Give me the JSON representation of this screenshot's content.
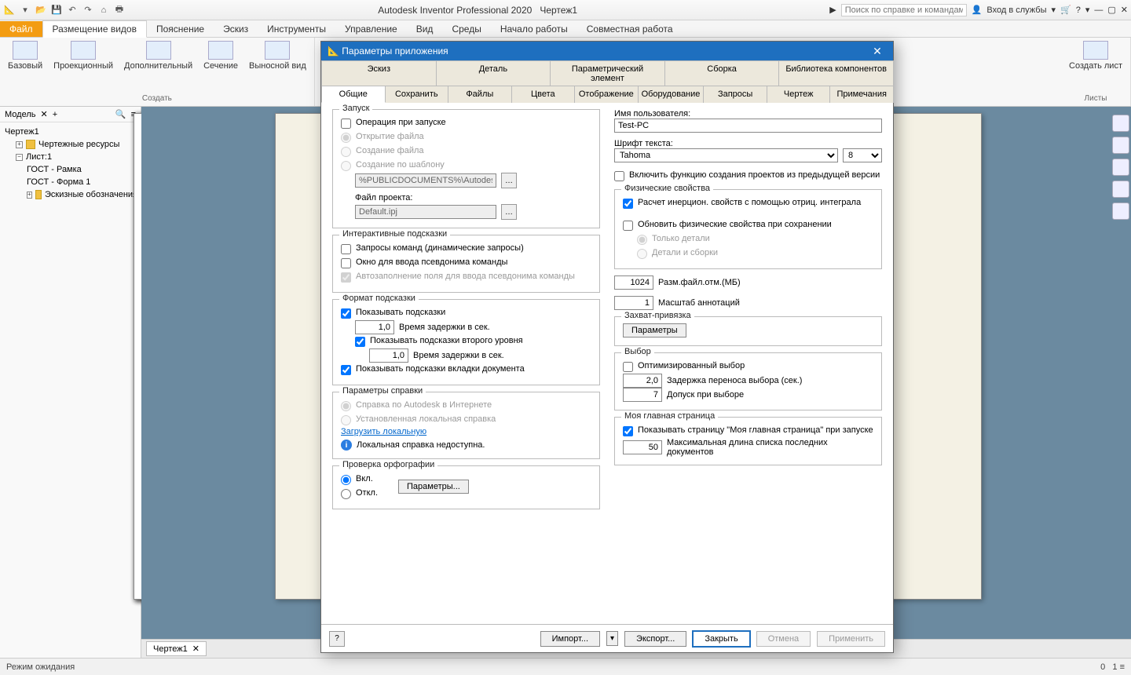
{
  "app": {
    "title": "Autodesk Inventor Professional 2020",
    "doc": "Чертеж1"
  },
  "qat": {
    "search_placeholder": "Поиск по справке и командам.",
    "signin": "Вход в службы"
  },
  "ribbon": {
    "file": "Файл",
    "tabs": [
      "Размещение видов",
      "Пояснение",
      "Эскиз",
      "Инструменты",
      "Управление",
      "Вид",
      "Среды",
      "Начало работы",
      "Совместная работа"
    ],
    "active_tab": 0,
    "groups": {
      "create": {
        "label": "Создать",
        "items": [
          "Базовый",
          "Проекционный",
          "Дополнительный",
          "Сечение",
          "Выносной вид"
        ]
      },
      "sheets": {
        "label": "Листы",
        "items": [
          "Создать лист"
        ]
      }
    }
  },
  "model": {
    "title": "Модель",
    "root": "Чертеж1",
    "resources": "Чертежные ресурсы",
    "sheet": "Лист:1",
    "children": [
      "ГОСТ - Рамка",
      "ГОСТ - Форма 1",
      "Эскизные обозначения"
    ]
  },
  "doc_tab": "Чертеж1",
  "status": {
    "left": "Режим ожидания",
    "right1": "0",
    "right2": "1"
  },
  "dialog": {
    "title": "Параметры приложения",
    "tabs_row1": [
      "Эскиз",
      "Деталь",
      "Параметрический элемент",
      "Сборка",
      "Библиотека компонентов"
    ],
    "tabs_row2": [
      "Общие",
      "Сохранить",
      "Файлы",
      "Цвета",
      "Отображение",
      "Оборудование",
      "Запросы",
      "Чертеж",
      "Примечания"
    ],
    "active": "Общие",
    "startup": {
      "title": "Запуск",
      "op_label": "Операция при запуске",
      "r1": "Открытие файла",
      "r2": "Создание файла",
      "r3": "Создание по шаблону",
      "template_path": "%PUBLICDOCUMENTS%\\Autodesk\\Inv",
      "project_label": "Файл проекта:",
      "project_file": "Default.ipj"
    },
    "hints": {
      "title": "Интерактивные подсказки",
      "c1": "Запросы команд (динамические запросы)",
      "c2": "Окно для ввода псевдонима команды",
      "c3": "Автозаполнение поля для ввода псевдонима команды"
    },
    "tooltip_fmt": {
      "title": "Формат подсказки",
      "show": "Показывать подсказки",
      "delay1": "1,0",
      "delay_lbl": "Время задержки в сек.",
      "show2": "Показывать подсказки второго уровня",
      "delay2": "1,0",
      "show_doc": "Показывать подсказки вкладки документа"
    },
    "help": {
      "title": "Параметры справки",
      "r1": "Справка по Autodesk в Интернете",
      "r2": "Установленная локальная справка",
      "link": "Загрузить локальную",
      "warn": "Локальная справка недоступна."
    },
    "spell": {
      "title": "Проверка орфографии",
      "on": "Вкл.",
      "off": "Откл.",
      "btn": "Параметры..."
    },
    "user": {
      "label": "Имя пользователя:",
      "value": "Test-PC"
    },
    "font": {
      "label": "Шрифт текста:",
      "name": "Tahoma",
      "size": "8"
    },
    "legacy_proj": "Включить функцию создания проектов из предыдущей версии",
    "phys": {
      "title": "Физические свойства",
      "c1": "Расчет инерцион. свойств с помощью отриц. интеграла",
      "c2": "Обновить физические свойства при сохранении",
      "r1": "Только детали",
      "r2": "Детали и сборки"
    },
    "undo": {
      "val": "1024",
      "lbl": "Разм.файл.отм.(МБ)"
    },
    "anno": {
      "val": "1",
      "lbl": "Масштаб аннотаций"
    },
    "snap": {
      "title": "Захват-привязка",
      "btn": "Параметры"
    },
    "select": {
      "title": "Выбор",
      "opt": "Оптимизированный выбор",
      "delay_val": "2,0",
      "delay_lbl": "Задержка переноса выбора (сек.)",
      "tol_val": "7",
      "tol_lbl": "Допуск при выборе"
    },
    "home": {
      "title": "Моя главная страница",
      "show": "Показывать страницу \"Моя главная страница\" при запуске",
      "max_val": "50",
      "max_lbl": "Максимальная длина списка последних документов"
    },
    "footer": {
      "import": "Импорт...",
      "export": "Экспорт...",
      "close": "Закрыть",
      "cancel": "Отмена",
      "apply": "Применить"
    }
  }
}
